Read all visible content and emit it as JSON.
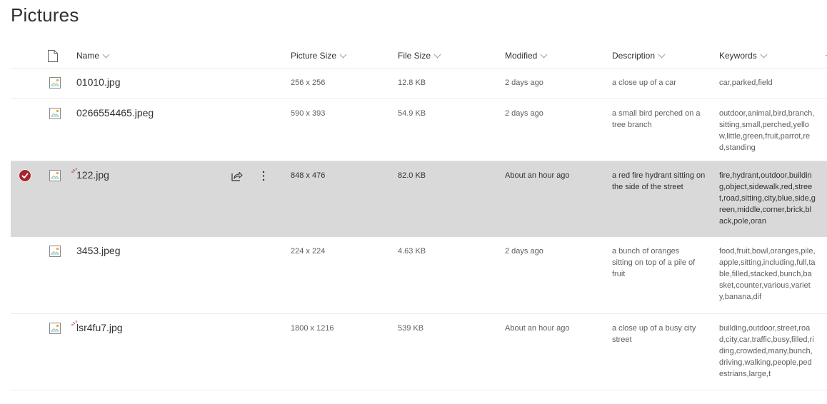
{
  "page": {
    "title": "Pictures"
  },
  "columns": {
    "type_icon": "file-type-icon",
    "name": "Name",
    "picture_size": "Picture Size",
    "file_size": "File Size",
    "modified": "Modified",
    "description": "Description",
    "keywords": "Keywords"
  },
  "colors": {
    "selected_row": "#d9d9d9",
    "check_accent": "#a4262c",
    "new_marker": "#a4262c"
  },
  "rows": [
    {
      "name": "01010.jpg",
      "picture_size": "256 x 256",
      "file_size": "12.8 KB",
      "modified": "2 days ago",
      "description": "a close up of a car",
      "keywords": "car,parked,field",
      "selected": false,
      "is_new": false
    },
    {
      "name": "0266554465.jpeg",
      "picture_size": "590 x 393",
      "file_size": "54.9 KB",
      "modified": "2 days ago",
      "description": "a small bird perched on a tree branch",
      "keywords": "outdoor,animal,bird,branch,sitting,small,perched,yellow,little,green,fruit,parrot,red,standing",
      "selected": false,
      "is_new": false
    },
    {
      "name": "122.jpg",
      "picture_size": "848 x 476",
      "file_size": "82.0 KB",
      "modified": "About an hour ago",
      "description": "a red fire hydrant sitting on the side of the street",
      "keywords": "fire,hydrant,outdoor,building,object,sidewalk,red,street,road,sitting,city,blue,side,green,middle,corner,brick,black,pole,oran",
      "selected": true,
      "is_new": true,
      "actions": {
        "share": "share-icon",
        "more": "more-options-icon"
      }
    },
    {
      "name": "3453.jpeg",
      "picture_size": "224 x 224",
      "file_size": "4.63 KB",
      "modified": "2 days ago",
      "description": "a bunch of oranges sitting on top of a pile of fruit",
      "keywords": "food,fruit,bowl,oranges,pile,apple,sitting,including,full,table,filled,stacked,bunch,basket,counter,various,variety,banana,dif",
      "selected": false,
      "is_new": false
    },
    {
      "name": "lsr4fu7.jpg",
      "picture_size": "1800 x 1216",
      "file_size": "539 KB",
      "modified": "About an hour ago",
      "description": "a close up of a busy city street",
      "keywords": "building,outdoor,street,road,city,car,traffic,busy,filled,riding,crowded,many,bunch,driving,walking,people,pedestrians,large,t",
      "selected": false,
      "is_new": true
    }
  ]
}
